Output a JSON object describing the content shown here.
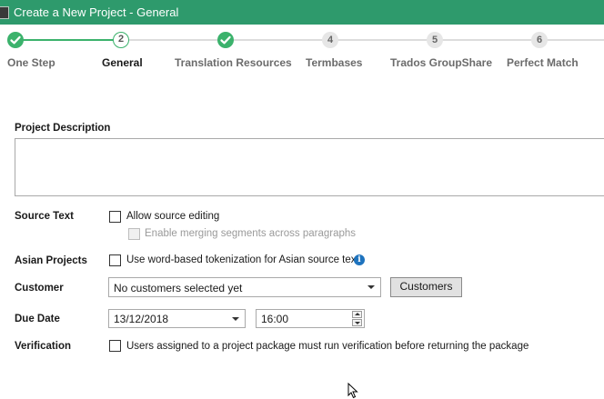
{
  "window": {
    "title": "Create a New Project - General"
  },
  "wizard": {
    "steps": [
      {
        "number": "",
        "label": "One Step",
        "state": "done"
      },
      {
        "number": "2",
        "label": "General",
        "state": "current"
      },
      {
        "number": "",
        "label": "Translation Resources",
        "state": "done"
      },
      {
        "number": "4",
        "label": "Termbases",
        "state": "todo"
      },
      {
        "number": "5",
        "label": "Trados GroupShare",
        "state": "todo"
      },
      {
        "number": "6",
        "label": "Perfect Match",
        "state": "todo"
      }
    ]
  },
  "form": {
    "project_description": {
      "label": "Project Description",
      "value": ""
    },
    "source_text": {
      "label": "Source Text",
      "allow_editing": "Allow source editing",
      "merging": "Enable merging segments across paragraphs"
    },
    "asian_projects": {
      "label": "Asian Projects",
      "tokenization": "Use word-based tokenization for Asian source text"
    },
    "customer": {
      "label": "Customer",
      "selected": "No customers selected yet",
      "button": "Customers"
    },
    "due_date": {
      "label": "Due Date",
      "date": "13/12/2018",
      "time": "16:00"
    },
    "verification": {
      "label": "Verification",
      "text": "Users assigned to a project package must run verification before returning the package"
    }
  },
  "colors": {
    "titlebar": "#2e9a6c",
    "step_done": "#3bb26c",
    "step_todo": "#e6e6e6",
    "info": "#1e73be"
  }
}
